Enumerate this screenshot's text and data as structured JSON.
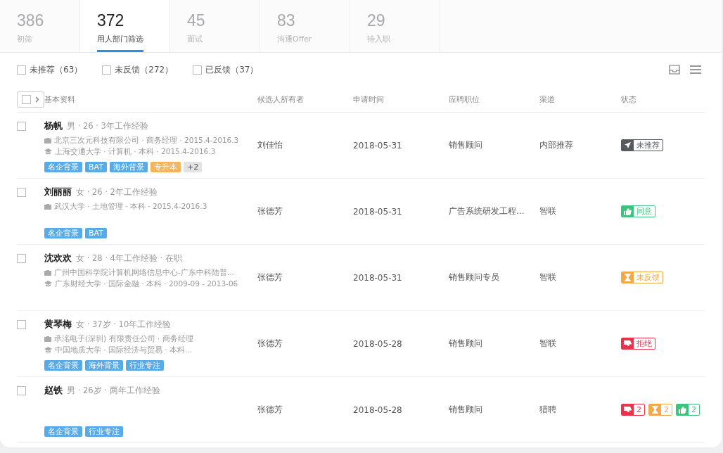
{
  "tabs": [
    {
      "count": "386",
      "label": "初筛",
      "selected": false
    },
    {
      "count": "372",
      "label": "用人部门筛选",
      "selected": true
    },
    {
      "count": "45",
      "label": "面试",
      "selected": false
    },
    {
      "count": "83",
      "label": "沟通Offer",
      "selected": false
    },
    {
      "count": "29",
      "label": "待入职",
      "selected": false
    }
  ],
  "filters": [
    {
      "label": "未推荐（63）",
      "checked": false
    },
    {
      "label": "未反馈（272）",
      "checked": false
    },
    {
      "label": "已反馈（37）",
      "checked": false
    }
  ],
  "table": {
    "select_all_checked": false,
    "columns": [
      "基本资料",
      "候选人所有者",
      "申请时间",
      "应聘职位",
      "渠道",
      "状态"
    ],
    "rows": [
      {
        "checked": false,
        "name": "杨帆",
        "meta": "男 · 26 · 3年工作经验",
        "details": [
          {
            "kind": "work",
            "text": "北京三次元科技有限公司 · 商务经理 · 2015.4-2016.3"
          },
          {
            "kind": "education",
            "text": "上海交通大学 · 计算机 · 本科 · 2015.4-2016.3"
          }
        ],
        "tags": [
          {
            "label": "名企背景",
            "color": "#58abe6"
          },
          {
            "label": "BAT",
            "color": "#58abe6"
          },
          {
            "label": "海外背景",
            "color": "#58abe6"
          },
          {
            "label": "专升本",
            "color": "#f3b45c"
          },
          {
            "label": "+2",
            "color": "#e2e3e5"
          }
        ],
        "owner": "刘佳怡",
        "date": "2018-05-31",
        "position": "销售顾问",
        "channel": "内部推荐",
        "status": [
          {
            "kind": "not-recommended",
            "text": "未推荐"
          }
        ]
      },
      {
        "checked": false,
        "name": "刘丽丽",
        "meta": "女 · 26 · 2年工作经验",
        "details": [
          {
            "kind": "work",
            "text": "武汉大学 · 土地管理 · 本科 · 2015.4-2016.3"
          }
        ],
        "tags": [
          {
            "label": "名企背景",
            "color": "#58abe6"
          },
          {
            "label": "BAT",
            "color": "#58abe6"
          }
        ],
        "owner": "张德芳",
        "date": "2018-05-31",
        "position": "广告系统研发工程...",
        "channel": "智联",
        "status": [
          {
            "kind": "agree",
            "text": "同意"
          }
        ]
      },
      {
        "checked": false,
        "name": "沈欢欢",
        "meta": "女 · 28 · 4年工作经验 · 在职",
        "details": [
          {
            "kind": "work",
            "text": "广州中国科学院计算机网络信息中心-广东中科陆普..."
          },
          {
            "kind": "education",
            "text": "广东财经大学 · 国际金融 · 本科 · 2009-09 - 2013-06"
          }
        ],
        "tags": [],
        "owner": "张德芳",
        "date": "2018-05-31",
        "position": "销售顾问专员",
        "channel": "智联",
        "status": [
          {
            "kind": "pending",
            "text": "未反馈"
          }
        ]
      },
      {
        "checked": false,
        "name": "黄琴梅",
        "meta": "女 · 37岁 · 10年工作经验",
        "details": [
          {
            "kind": "work",
            "text": "承洺电子(深圳) 有限责任公司 · 商务经理"
          },
          {
            "kind": "education",
            "text": "中国地质大学 · 国际经济与贸易 · 本科..."
          }
        ],
        "tags": [
          {
            "label": "名企背景",
            "color": "#58abe6"
          },
          {
            "label": "海外背景",
            "color": "#58abe6"
          },
          {
            "label": "行业专注",
            "color": "#58abe6"
          }
        ],
        "owner": "张德芳",
        "date": "2018-05-28",
        "position": "销售顾问",
        "channel": "智联",
        "status": [
          {
            "kind": "reject",
            "text": "拒绝"
          }
        ]
      },
      {
        "checked": false,
        "name": "赵铁",
        "meta": "男 · 26岁 · 两年工作经验",
        "details": [],
        "tags": [
          {
            "label": "名企背景",
            "color": "#58abe6"
          },
          {
            "label": "行业专注",
            "color": "#58abe6"
          }
        ],
        "owner": "张德芳",
        "date": "2018-05-28",
        "position": "销售顾问",
        "channel": "猎聘",
        "status": [
          {
            "kind": "reject",
            "text": "2"
          },
          {
            "kind": "pending",
            "text": "2"
          },
          {
            "kind": "agree",
            "text": "2"
          }
        ]
      }
    ]
  }
}
